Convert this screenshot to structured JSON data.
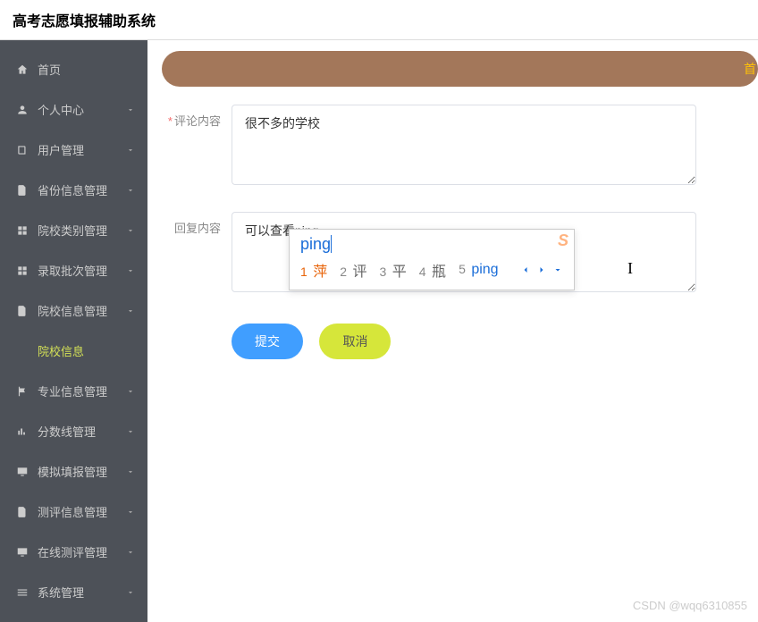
{
  "header": {
    "title": "高考志愿填报辅助系统"
  },
  "sidebar": {
    "items": [
      {
        "label": "首页",
        "icon": "home",
        "expandable": false
      },
      {
        "label": "个人中心",
        "icon": "user",
        "expandable": true
      },
      {
        "label": "用户管理",
        "icon": "book",
        "expandable": true
      },
      {
        "label": "省份信息管理",
        "icon": "doc",
        "expandable": true
      },
      {
        "label": "院校类别管理",
        "icon": "grid",
        "expandable": true
      },
      {
        "label": "录取批次管理",
        "icon": "grid",
        "expandable": true
      },
      {
        "label": "院校信息管理",
        "icon": "doc",
        "expandable": true
      },
      {
        "label": "院校信息",
        "icon": null,
        "active": true,
        "expandable": false
      },
      {
        "label": "专业信息管理",
        "icon": "flag",
        "expandable": true
      },
      {
        "label": "分数线管理",
        "icon": "bars",
        "expandable": true
      },
      {
        "label": "模拟填报管理",
        "icon": "monitor",
        "expandable": true
      },
      {
        "label": "测评信息管理",
        "icon": "doc",
        "expandable": true
      },
      {
        "label": "在线测评管理",
        "icon": "monitor",
        "expandable": true
      },
      {
        "label": "系统管理",
        "icon": "menu",
        "expandable": true
      }
    ]
  },
  "banner": {
    "right_text": "首"
  },
  "form": {
    "comment": {
      "label": "评论内容",
      "required": true,
      "value": "很不多的学校"
    },
    "reply": {
      "label": "回复内容",
      "value": "可以查看ping"
    },
    "submit_label": "提交",
    "cancel_label": "取消"
  },
  "ime": {
    "input": "ping",
    "candidates": [
      {
        "num": "1",
        "char": "萍",
        "selected": true
      },
      {
        "num": "2",
        "char": "评"
      },
      {
        "num": "3",
        "char": "平"
      },
      {
        "num": "4",
        "char": "瓶"
      },
      {
        "num": "5",
        "char": "ping",
        "blue": true
      }
    ]
  },
  "watermark": "CSDN @wqq6310855"
}
